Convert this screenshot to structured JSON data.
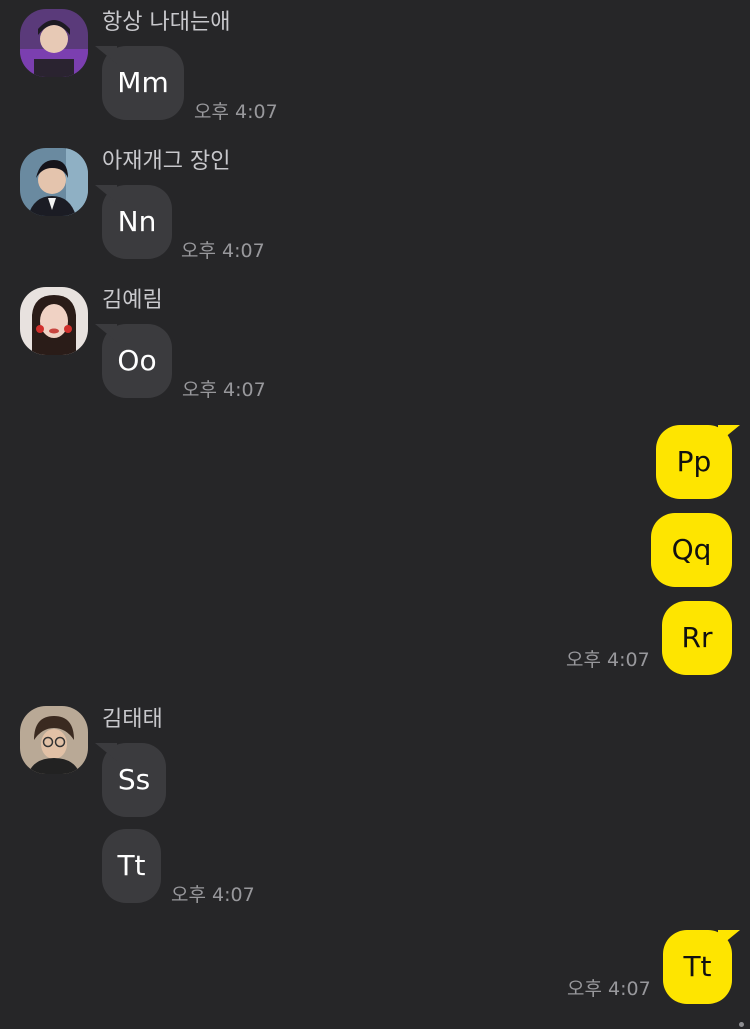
{
  "messages": {
    "m1": {
      "sender": "항상 나대는애",
      "text": "Mm",
      "time": "오후 4:07"
    },
    "m2": {
      "sender": "아재개그 장인",
      "text": "Nn",
      "time": "오후 4:07"
    },
    "m3": {
      "sender": "김예림",
      "text": "Oo",
      "time": "오후 4:07"
    },
    "mine1": {
      "texts": [
        "Pp",
        "Qq",
        "Rr"
      ],
      "time": "오후 4:07"
    },
    "m4": {
      "sender": "김태태",
      "texts": [
        "Ss",
        "Tt"
      ],
      "time": "오후 4:07"
    },
    "mine2": {
      "text": "Tt",
      "time": "오후 4:07"
    }
  },
  "colors": {
    "background": "#262628",
    "incoming_bubble": "#3b3b3e",
    "outgoing_bubble": "#fee500",
    "sender_name": "#c8c8cc",
    "timestamp": "#98989c"
  }
}
